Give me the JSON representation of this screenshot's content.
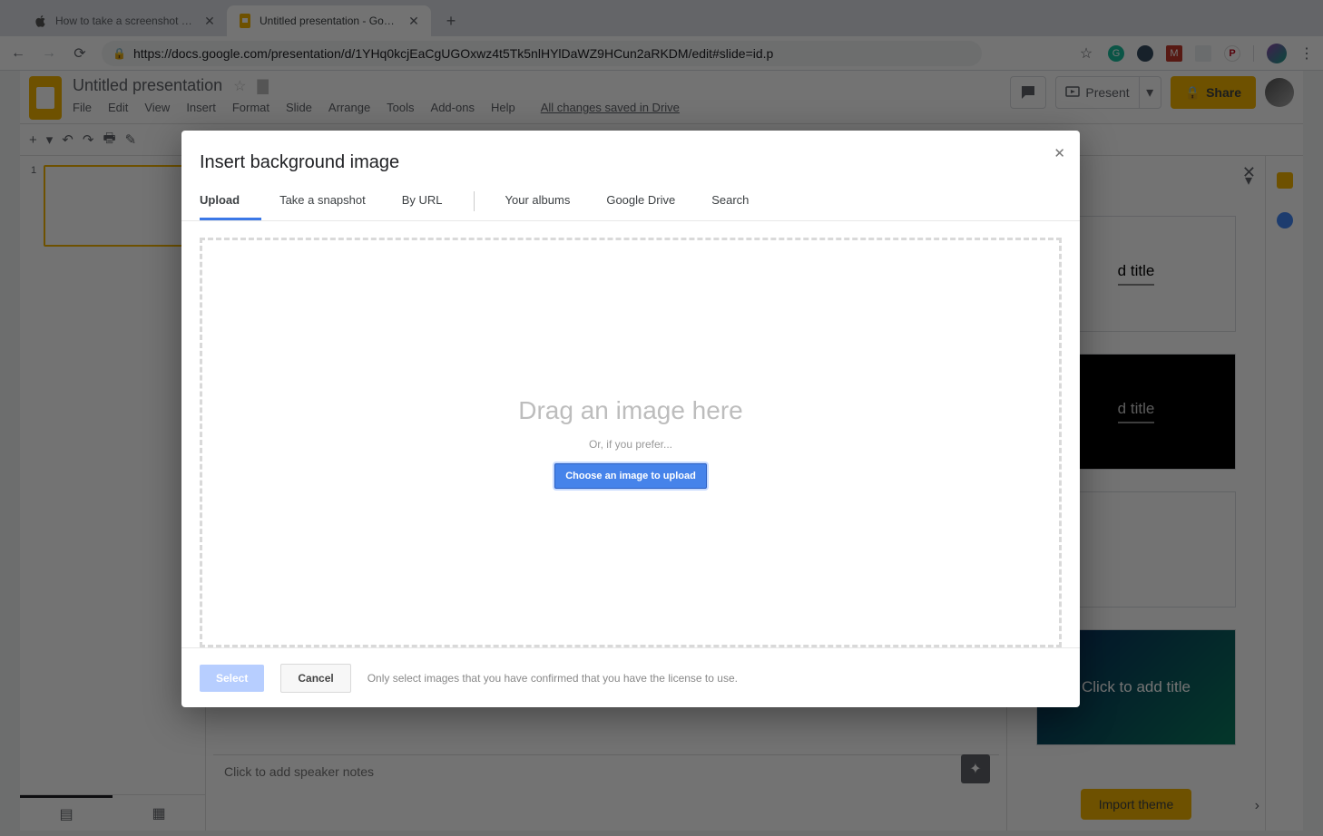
{
  "browser": {
    "tabs": [
      {
        "title": "How to take a screenshot on yo",
        "active": false
      },
      {
        "title": "Untitled presentation - Google",
        "active": true
      }
    ],
    "url": "https://docs.google.com/presentation/d/1YHq0kcjEaCgUGOxwz4t5Tk5nlHYlDaWZ9HCun2aRKDM/edit#slide=id.p"
  },
  "app": {
    "doc_name": "Untitled presentation",
    "menus": [
      "File",
      "Edit",
      "View",
      "Insert",
      "Format",
      "Slide",
      "Arrange",
      "Tools",
      "Add-ons",
      "Help"
    ],
    "save_status": "All changes saved in Drive",
    "present": "Present",
    "share": "Share",
    "thumb_number": "1",
    "speaker_placeholder": "Click to add speaker notes",
    "theme_title_text": "d title",
    "theme_title_text2": "Click to add title",
    "import_theme": "Import theme"
  },
  "dialog": {
    "title": "Insert background image",
    "tabs": [
      "Upload",
      "Take a snapshot",
      "By URL",
      "Your albums",
      "Google Drive",
      "Search"
    ],
    "drag_text": "Drag an image here",
    "or_text": "Or, if you prefer...",
    "choose_btn": "Choose an image to upload",
    "select": "Select",
    "cancel": "Cancel",
    "footnote": "Only select images that you have confirmed that you have the license to use."
  }
}
